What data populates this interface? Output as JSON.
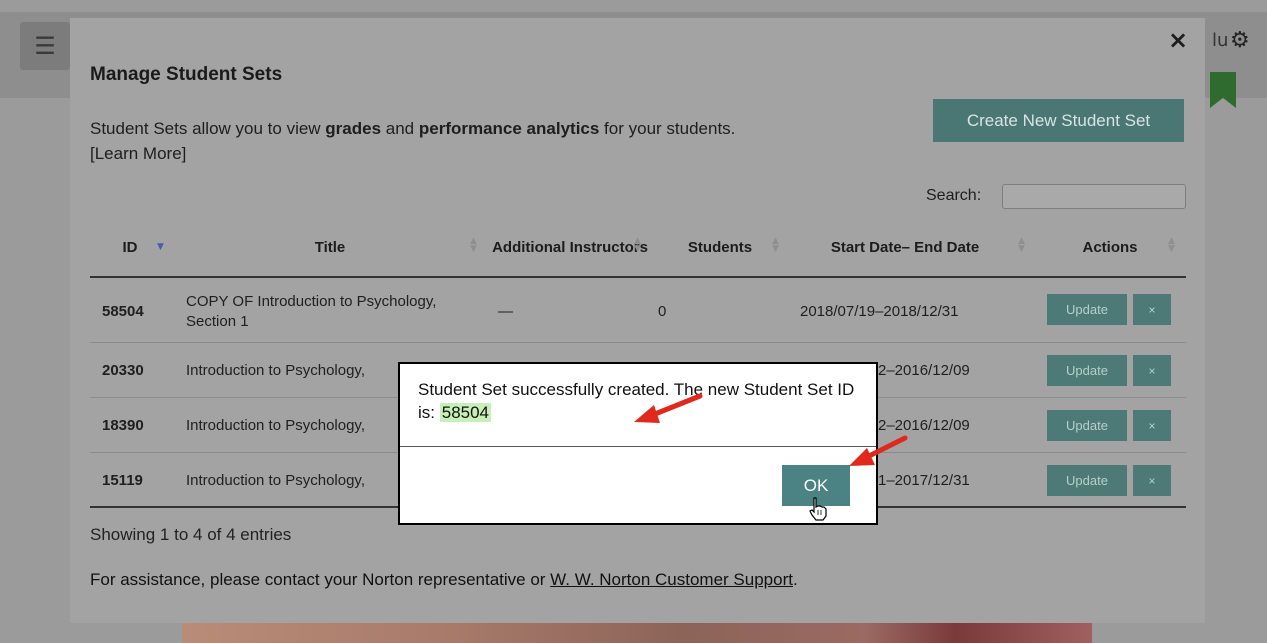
{
  "background": {
    "menu_icon": "hamburger-icon",
    "user_partial": "lu",
    "gear_icon": "gear-icon"
  },
  "modal": {
    "title": "Manage Student Sets",
    "close_glyph": "×",
    "intro_prefix": "Student Sets allow you to view ",
    "intro_bold1": "grades",
    "intro_mid": " and ",
    "intro_bold2": "performance analytics",
    "intro_suffix": " for your students.",
    "learn_more": "[Learn More]",
    "create_button": "Create New Student Set",
    "search_label": "Search:",
    "search_value": ""
  },
  "table": {
    "columns": [
      {
        "label": "ID"
      },
      {
        "label": "Title"
      },
      {
        "label": "Additional Instructors"
      },
      {
        "label": "Students"
      },
      {
        "label": "Start Date– End Date"
      },
      {
        "label": "Actions"
      }
    ],
    "rows": [
      {
        "id": "58504",
        "title": "COPY OF Introduction to Psychology, Section 1",
        "instructors": "—",
        "students": "0",
        "dates": "2018/07/19–2018/12/31",
        "update": "Update",
        "delete": "×"
      },
      {
        "id": "20330",
        "title": "Introduction to Psychology,",
        "instructors": "",
        "students": "",
        "dates": "2–2016/12/09",
        "update": "Update",
        "delete": "×"
      },
      {
        "id": "18390",
        "title": "Introduction to Psychology,",
        "instructors": "",
        "students": "",
        "dates": "2–2016/12/09",
        "update": "Update",
        "delete": "×"
      },
      {
        "id": "15119",
        "title": "Introduction to Psychology,",
        "instructors": "",
        "students": "",
        "dates": "1–2017/12/31",
        "update": "Update",
        "delete": "×"
      }
    ]
  },
  "footer": {
    "showing": "Showing 1 to 4 of 4 entries",
    "help_prefix": "For assistance, please contact your Norton representative or ",
    "help_link": "W. W. Norton Customer Support",
    "help_suffix": "."
  },
  "dialog": {
    "message_line": "Student Set successfully created. The new Student Set ID is: ",
    "new_id": "58504",
    "ok_label": "OK"
  },
  "colors": {
    "accent_button": "#4a7674",
    "ok_button": "#4b8284",
    "id_highlight": "#c6f0b8",
    "annotation_arrow": "#e0281c"
  }
}
